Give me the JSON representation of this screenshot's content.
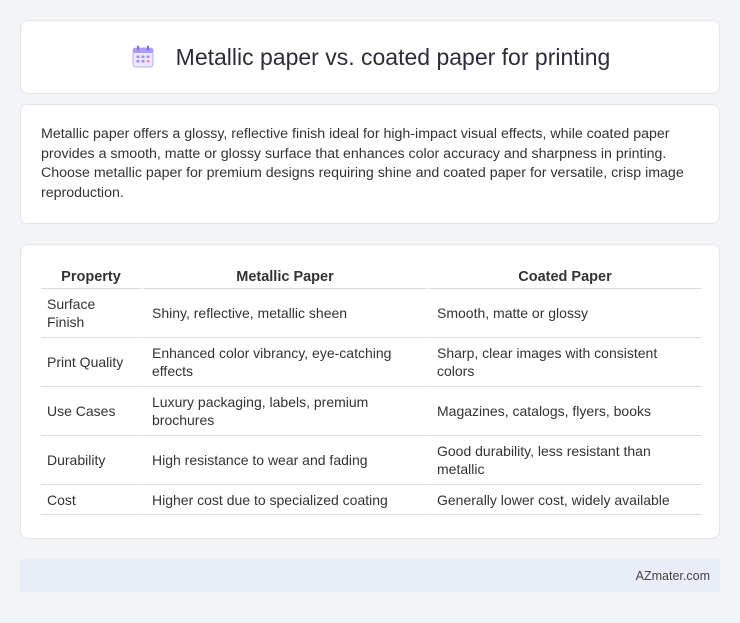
{
  "header": {
    "title": "Metallic paper vs. coated paper for printing",
    "icon": "calendar-icon"
  },
  "summary": {
    "text": "Metallic paper offers a glossy, reflective finish ideal for high-impact visual effects, while coated paper provides a smooth, matte or glossy surface that enhances color accuracy and sharpness in printing. Choose metallic paper for premium designs requiring shine and coated paper for versatile, crisp image reproduction."
  },
  "table": {
    "headers": [
      "Property",
      "Metallic Paper",
      "Coated Paper"
    ],
    "rows": [
      [
        "Surface Finish",
        "Shiny, reflective, metallic sheen",
        "Smooth, matte or glossy"
      ],
      [
        "Print Quality",
        "Enhanced color vibrancy, eye-catching effects",
        "Sharp, clear images with consistent colors"
      ],
      [
        "Use Cases",
        "Luxury packaging, labels, premium brochures",
        "Magazines, catalogs, flyers, books"
      ],
      [
        "Durability",
        "High resistance to wear and fading",
        "Good durability, less resistant than metallic"
      ],
      [
        "Cost",
        "Higher cost due to specialized coating",
        "Generally lower cost, widely available"
      ]
    ]
  },
  "footer": {
    "brand": "AZmater.com"
  },
  "colors": {
    "page_bg": "#f3f4f6",
    "card_bg": "#ffffff",
    "footer_bg": "#e9edf7",
    "icon_accent": "#8b7cf6"
  }
}
